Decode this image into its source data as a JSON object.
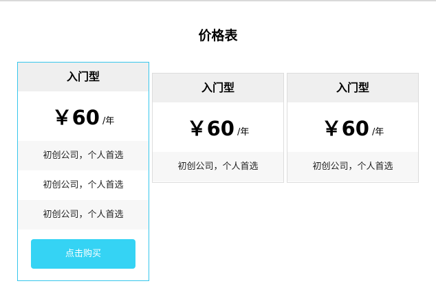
{
  "page": {
    "title": "价格表"
  },
  "plans": [
    {
      "name": "入门型",
      "price": "￥60",
      "unit": "/年",
      "features": [
        "初创公司，个人首选",
        "初创公司，个人首选",
        "初创公司，个人首选"
      ],
      "button_label": "点击购买"
    },
    {
      "name": "入门型",
      "price": "￥60",
      "unit": "/年",
      "features": [
        "初创公司，个人首选"
      ]
    },
    {
      "name": "入门型",
      "price": "￥60",
      "unit": "/年",
      "features": [
        "初创公司，个人首选"
      ]
    }
  ],
  "colors": {
    "accent": "#35d3f4",
    "active_border": "#35c6ec",
    "header_bg": "#efefef",
    "alt_row_bg": "#f7f7f7"
  }
}
